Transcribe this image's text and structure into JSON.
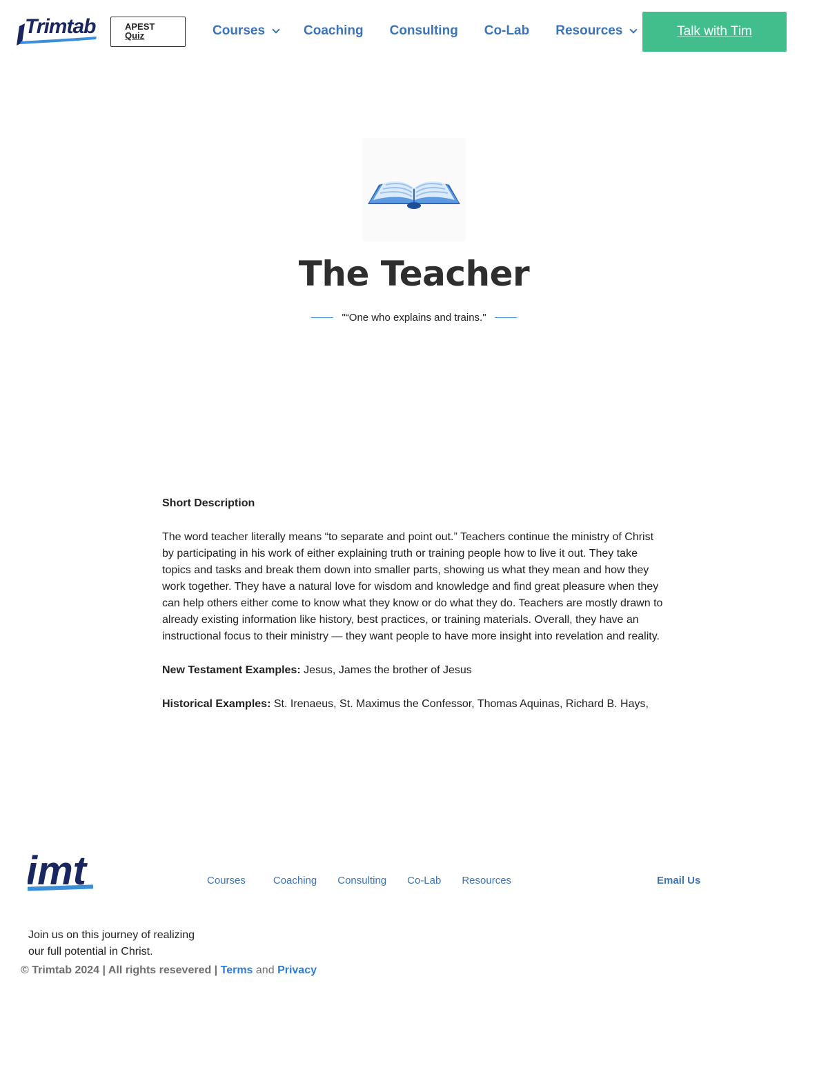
{
  "header": {
    "logo_text": "Trimtab",
    "quiz_button": {
      "line1": "APEST",
      "line2": "Quiz"
    },
    "nav": {
      "courses": "Courses",
      "coaching": "Coaching",
      "consulting": "Consulting",
      "colab": "Co-Lab",
      "resources": "Resources"
    },
    "cta_label": "Talk with Tim"
  },
  "hero": {
    "icon": "open-book-icon",
    "title": "The Teacher",
    "tagline": "\"“One who explains and trains.\""
  },
  "content": {
    "short_description_heading": "Short Description",
    "short_description": "The word teacher literally means “to separate and point out.” Teachers continue the ministry of Christ by participating in his work of either explaining truth or training people how to live it out. They take topics and tasks and break them down into smaller parts, showing us what they mean and how they work together. They have a natural love for wisdom and knowledge and find great pleasure when they can help others either come to know what they know or do what they do. Teachers are mostly drawn to already existing information like history, best practices, or training materials. Overall, they have an instructional focus to their ministry — they want people to have more insight into revelation and reality.",
    "nt_label": "New Testament Examples:",
    "nt_value": "Jesus, James the brother of Jesus",
    "hist_label": "Historical Examples:",
    "hist_value": "St. Irenaeus, St. Maximus the Confessor, Thomas Aquinas, Richard B. Hays,"
  },
  "footer": {
    "logo_text": "imt",
    "nav": {
      "courses": "Courses",
      "coaching": "Coaching",
      "consulting": "Consulting",
      "colab": "Co-Lab",
      "resources": "Resources"
    },
    "email": "Email Us",
    "tagline": "Join us on this journey of realizing our full potential in Christ.",
    "copyright": "© Trimtab 2024 | All rights resevered |",
    "terms": "Terms",
    "and": "and",
    "privacy": "Privacy"
  },
  "colors": {
    "brand_navy": "#1a2660",
    "link_blue": "#3b74b8",
    "cta_green": "#42bd8c",
    "accent_blue": "#2f7cd4"
  }
}
